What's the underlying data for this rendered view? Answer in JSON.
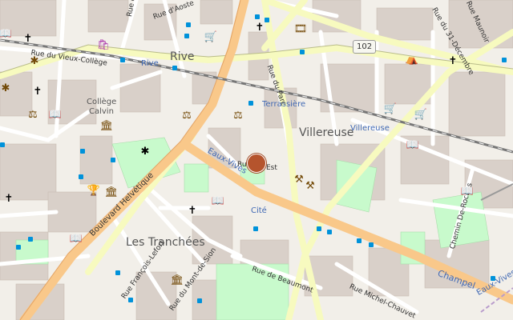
{
  "map": {
    "labels": {
      "rive": "Rive",
      "rive_station": "Rive",
      "villereuse": "Villereuse",
      "villereuse_station": "Villereuse",
      "terrassiere": "Terrassière",
      "les_tranchees": "Les Tranchées",
      "college_calvin_1": "Collège",
      "college_calvin_2": "Calvin",
      "eaux_vives_1": "Eaux-Vives",
      "eaux_vives_2": "Eaux-Vives",
      "cite": "Cité",
      "champel": "Champel",
      "rue_ditalie": "Rue d'Italie",
      "rue_daoste": "Rue d'Aoste",
      "rue_du_vieux_college": "Rue du Vieux-Collège",
      "rue_du_parc": "Rue du Parc",
      "rue_du_31_decembre": "Rue du 31-Décembre",
      "boulevard_helvetique": "Boulevard Helvétique",
      "rue_francois_le_fort": "Rue François-Lefort",
      "rue_du_mont_de_sion": "Rue du Mont-de-Sion",
      "rue_de_beaumont": "Rue de Beaumont",
      "rue_michel_chauvet": "Rue Michel-Chauvet",
      "chemin_de_roches": "Chemin De-Roches",
      "rue_est_1": "Ru",
      "rue_est_2": "Est",
      "rue_maunoir": "Rue Maunoir",
      "route_number": "102"
    },
    "colors": {
      "background": "#f2efe9",
      "major_road": "#f9c88a",
      "secondary_road": "#f7fabf",
      "minor_road": "#ffffff",
      "park": "#c8facc",
      "building": "#d9d0c9",
      "railway": "#777777",
      "marker": "#b5542d",
      "bus_stop": "#0092da",
      "shop": "#ac39ac",
      "icon_brown": "#734a08"
    },
    "icons": [
      "church-icon",
      "bus-stop-icon",
      "shop-icon",
      "museum-icon",
      "library-icon",
      "court-icon",
      "cinema-icon",
      "viewpoint-icon",
      "location-marker-icon"
    ]
  }
}
